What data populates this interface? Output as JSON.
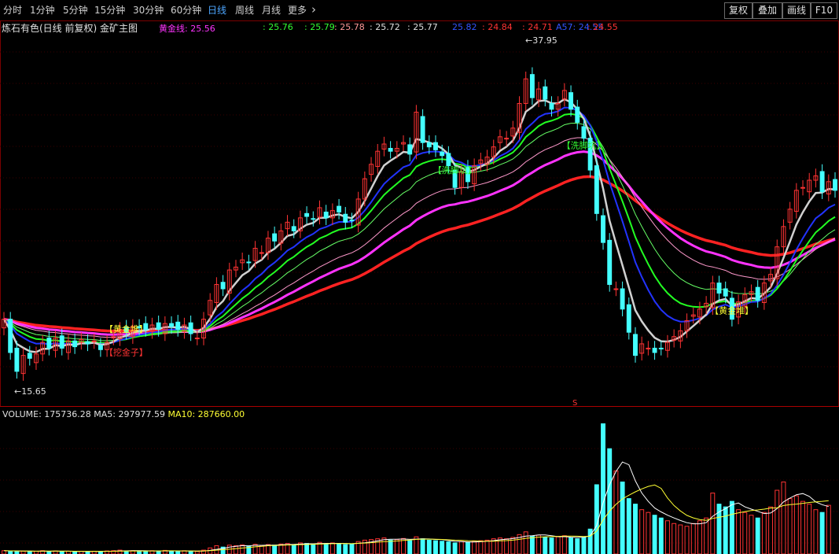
{
  "toolbar": {
    "periods": [
      "分时",
      "1分钟",
      "5分钟",
      "15分钟",
      "30分钟",
      "60分钟",
      "日线",
      "周线",
      "月线",
      "更多"
    ],
    "active_period": "日线",
    "more_arrow": "›",
    "right_buttons": [
      "复权",
      "叠加",
      "画线",
      "F10"
    ]
  },
  "header": {
    "title": "炼石有色(日线 前复权) 金矿主图",
    "gold_line_label": "黄金线",
    "gold_line_value": "25.56",
    "values": [
      {
        "text": ": 25.76",
        "color": "#33ff33"
      },
      {
        "text": ": 25.79",
        "color": "#33ff33"
      },
      {
        "text": ": 25.78",
        "color": "#ff9999"
      },
      {
        "text": ": 25.72",
        "color": "#e0e0e0"
      },
      {
        "text": ": 25.77",
        "color": "#e0e0e0"
      },
      {
        "text": "25.82",
        "color": "#3355ff"
      },
      {
        "text": ": 24.84",
        "color": "#ff3333"
      },
      {
        "text": ": 24.71",
        "color": "#ff3333"
      },
      {
        "text": "A57: 24.55",
        "color": "#3355ff"
      },
      {
        "text": ": 24.55",
        "color": "#ff3333"
      }
    ]
  },
  "volume_header": {
    "volume": "VOLUME: 175736.28",
    "ma5": "MA5: 297977.59",
    "ma10": "MA10: 287660.00"
  },
  "colors": {
    "up": "#ff3333",
    "down": "#44ffff",
    "gold_line": "#ff33ff",
    "ma_red": "#ff2222",
    "ma_blue": "#2233ff",
    "ma_green": "#22ff22",
    "ma_white": "#d0d0d0",
    "bar_yellow": "#ffff33",
    "grid": "#7a0000",
    "vol_ma5": "#ffffff",
    "vol_ma10": "#ffff33"
  },
  "chart_data": {
    "type": "candlestick",
    "title": "炼石有色(日线 前复权) 金矿主图",
    "price_range": [
      14.5,
      39.5
    ],
    "max_label": "37.95",
    "min_label": "15.65",
    "signals": [
      "【黄金堆】",
      "【挖金子】",
      "【洗脚坑】",
      "【洗脚坑】",
      "【黄金堆】"
    ],
    "s_marker": "S",
    "close": [
      19.9,
      17.6,
      16.3,
      17.4,
      17.2,
      17.5,
      18.3,
      17.9,
      18.6,
      17.9,
      18.4,
      18.0,
      18.5,
      18.2,
      18.4,
      17.8,
      18.3,
      18.7,
      19.2,
      19.0,
      19.4,
      19.3,
      19.2,
      19.5,
      19.2,
      19.6,
      19.4,
      19.2,
      19.5,
      18.9,
      18.6,
      19.9,
      21.2,
      22.3,
      22.0,
      23.3,
      23.5,
      24.0,
      23.8,
      24.8,
      24.5,
      25.5,
      25.3,
      26.0,
      26.6,
      26.0,
      26.9,
      27.0,
      26.8,
      27.6,
      26.9,
      27.4,
      27.3,
      26.6,
      26.7,
      28.2,
      29.6,
      30.6,
      31.5,
      32.0,
      31.5,
      31.7,
      32.1,
      31.3,
      34.2,
      32.1,
      31.8,
      31.6,
      31.2,
      30.5,
      29.0,
      30.1,
      29.4,
      30.5,
      30.9,
      31.1,
      31.8,
      32.5,
      32.4,
      33.1,
      34.8,
      36.5,
      35.2,
      35.8,
      35.1,
      34.4,
      34.8,
      35.7,
      34.4,
      33.5,
      32.4,
      30.2,
      27.2,
      25.2,
      22.3,
      22.0,
      20.6,
      19.0,
      17.4,
      18.2,
      17.9,
      17.6,
      17.9,
      18.3,
      18.7,
      19.1,
      19.8,
      20.2,
      20.6,
      21.0,
      22.4,
      21.7,
      21.5,
      19.9,
      21.1,
      21.6,
      21.8,
      21.2,
      22.4,
      23.0,
      24.9,
      26.3,
      27.5,
      28.8,
      29.0,
      29.5,
      29.8,
      28.7,
      29.4,
      28.8
    ],
    "volume": [
      12000,
      11000,
      10000,
      10000,
      9000,
      10000,
      12000,
      9000,
      11000,
      9000,
      10000,
      8000,
      10000,
      9000,
      10000,
      9000,
      11000,
      12000,
      14000,
      11000,
      12000,
      11000,
      10000,
      12000,
      10000,
      13000,
      11000,
      10000,
      12000,
      9000,
      9000,
      14000,
      22000,
      30000,
      25000,
      32000,
      30000,
      33000,
      28000,
      35000,
      30000,
      34000,
      32000,
      36000,
      38000,
      33000,
      40000,
      38000,
      35000,
      42000,
      37000,
      40000,
      38000,
      34000,
      36000,
      45000,
      50000,
      52000,
      55000,
      58000,
      50000,
      52000,
      56000,
      48000,
      62000,
      55000,
      50000,
      48000,
      46000,
      44000,
      40000,
      45000,
      42000,
      46000,
      48000,
      50000,
      55000,
      58000,
      55000,
      60000,
      70000,
      80000,
      65000,
      68000,
      60000,
      58000,
      62000,
      66000,
      58000,
      55000,
      60000,
      90000,
      250000,
      470000,
      380000,
      300000,
      260000,
      200000,
      180000,
      160000,
      150000,
      140000,
      130000,
      120000,
      110000,
      105000,
      100000,
      110000,
      120000,
      130000,
      220000,
      180000,
      170000,
      190000,
      160000,
      150000,
      140000,
      130000,
      150000,
      170000,
      230000,
      260000,
      200000,
      210000,
      190000,
      180000,
      160000,
      150000,
      175736
    ],
    "ma5_vol_label": "MA5",
    "ma10_vol_label": "MA10"
  }
}
